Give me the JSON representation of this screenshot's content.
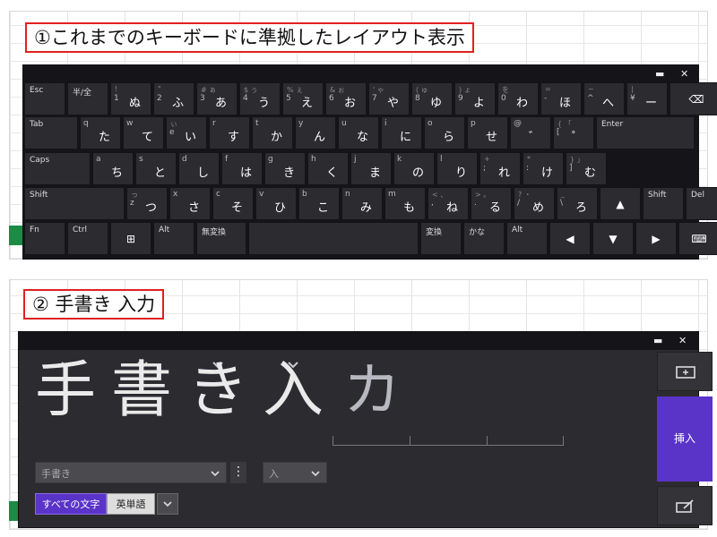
{
  "section1": {
    "caption": "①これまでのキーボードに準拠したレイアウト表示",
    "window": {
      "minimize": "▬",
      "close": "✕"
    },
    "rows": [
      [
        {
          "id": "esc",
          "label": "Esc"
        },
        {
          "id": "hankaku",
          "label": "半/全"
        },
        {
          "id": "1",
          "num": "1",
          "kana": "ぬ",
          "top": "!"
        },
        {
          "id": "2",
          "num": "2",
          "kana": "ふ",
          "top": "\""
        },
        {
          "id": "3",
          "num": "3",
          "kana": "あ",
          "top": "# ぁ"
        },
        {
          "id": "4",
          "num": "4",
          "kana": "う",
          "top": "$ ぅ"
        },
        {
          "id": "5",
          "num": "5",
          "kana": "え",
          "top": "% ぇ"
        },
        {
          "id": "6",
          "num": "6",
          "kana": "お",
          "top": "& ぉ"
        },
        {
          "id": "7",
          "num": "7",
          "kana": "や",
          "top": "' ゃ"
        },
        {
          "id": "8",
          "num": "8",
          "kana": "ゆ",
          "top": "( ゅ"
        },
        {
          "id": "9",
          "num": "9",
          "kana": "よ",
          "top": ") ょ"
        },
        {
          "id": "0",
          "num": "0",
          "kana": "わ",
          "top": "を"
        },
        {
          "id": "minus",
          "num": "-",
          "kana": "ほ",
          "top": "="
        },
        {
          "id": "caret",
          "num": "^",
          "kana": "へ",
          "top": "~"
        },
        {
          "id": "yen",
          "num": "¥",
          "kana": "ー",
          "top": "|"
        },
        {
          "id": "bksp",
          "label": "⌫"
        }
      ],
      [
        {
          "id": "tab",
          "label": "Tab"
        },
        {
          "id": "q",
          "num": "q",
          "kana": "た"
        },
        {
          "id": "w",
          "num": "w",
          "kana": "て"
        },
        {
          "id": "e",
          "num": "e",
          "kana": "い",
          "top": "ぃ"
        },
        {
          "id": "r",
          "num": "r",
          "kana": "す"
        },
        {
          "id": "t",
          "num": "t",
          "kana": "か"
        },
        {
          "id": "y",
          "num": "y",
          "kana": "ん"
        },
        {
          "id": "u",
          "num": "u",
          "kana": "な"
        },
        {
          "id": "i",
          "num": "i",
          "kana": "に"
        },
        {
          "id": "o",
          "num": "o",
          "kana": "ら"
        },
        {
          "id": "p",
          "num": "p",
          "kana": "せ"
        },
        {
          "id": "at",
          "num": "@",
          "kana": "゛"
        },
        {
          "id": "lbr",
          "num": "[",
          "kana": "゜",
          "top": "{ 「"
        },
        {
          "id": "enter",
          "label": "Enter"
        }
      ],
      [
        {
          "id": "caps",
          "label": "Caps"
        },
        {
          "id": "a",
          "num": "a",
          "kana": "ち"
        },
        {
          "id": "s",
          "num": "s",
          "kana": "と"
        },
        {
          "id": "d",
          "num": "d",
          "kana": "し"
        },
        {
          "id": "f",
          "num": "f",
          "kana": "は"
        },
        {
          "id": "g",
          "num": "g",
          "kana": "き"
        },
        {
          "id": "h",
          "num": "h",
          "kana": "く"
        },
        {
          "id": "j",
          "num": "j",
          "kana": "ま"
        },
        {
          "id": "k",
          "num": "k",
          "kana": "の"
        },
        {
          "id": "l",
          "num": "l",
          "kana": "り"
        },
        {
          "id": "semi",
          "num": ";",
          "kana": "れ",
          "top": "+"
        },
        {
          "id": "colon",
          "num": ":",
          "kana": "け",
          "top": "*"
        },
        {
          "id": "rbr",
          "num": "]",
          "kana": "む",
          "top": "} 」"
        }
      ],
      [
        {
          "id": "lshift",
          "label": "Shift"
        },
        {
          "id": "z",
          "num": "z",
          "kana": "つ",
          "top": "っ"
        },
        {
          "id": "x",
          "num": "x",
          "kana": "さ"
        },
        {
          "id": "c",
          "num": "c",
          "kana": "そ"
        },
        {
          "id": "v",
          "num": "v",
          "kana": "ひ"
        },
        {
          "id": "b",
          "num": "b",
          "kana": "こ"
        },
        {
          "id": "n",
          "num": "n",
          "kana": "み"
        },
        {
          "id": "m",
          "num": "m",
          "kana": "も"
        },
        {
          "id": "comma",
          "num": ",",
          "kana": "ね",
          "top": "< 、"
        },
        {
          "id": "period",
          "num": ".",
          "kana": "る",
          "top": "> 。"
        },
        {
          "id": "slash",
          "num": "/",
          "kana": "め",
          "top": "? ・"
        },
        {
          "id": "bslash",
          "num": "\\",
          "kana": "ろ",
          "top": "_"
        },
        {
          "id": "up",
          "label": "▲"
        },
        {
          "id": "rshift",
          "label": "Shift"
        },
        {
          "id": "del",
          "label": "Del"
        }
      ],
      [
        {
          "id": "fn",
          "label": "Fn"
        },
        {
          "id": "ctrl",
          "label": "Ctrl"
        },
        {
          "id": "win",
          "label": "⊞"
        },
        {
          "id": "alt",
          "label": "Alt"
        },
        {
          "id": "muhenkan",
          "label": "無変換"
        },
        {
          "id": "space",
          "label": ""
        },
        {
          "id": "henkan",
          "label": "変換"
        },
        {
          "id": "kana",
          "label": "かな"
        },
        {
          "id": "ralt",
          "label": "Alt"
        },
        {
          "id": "left",
          "label": "◀"
        },
        {
          "id": "down",
          "label": "▼"
        },
        {
          "id": "right",
          "label": "▶"
        },
        {
          "id": "kbdicon",
          "label": "⌨"
        }
      ]
    ]
  },
  "section2": {
    "caption": "② 手書き 入力",
    "window": {
      "minimize": "▬",
      "close": "✕"
    },
    "chars": [
      "手",
      "書",
      "き",
      "入"
    ],
    "ink": "カ",
    "candidate1": "手書き",
    "candidate2": "入",
    "tabs": [
      "すべての文字",
      "英単語"
    ],
    "insert": "挿入"
  }
}
